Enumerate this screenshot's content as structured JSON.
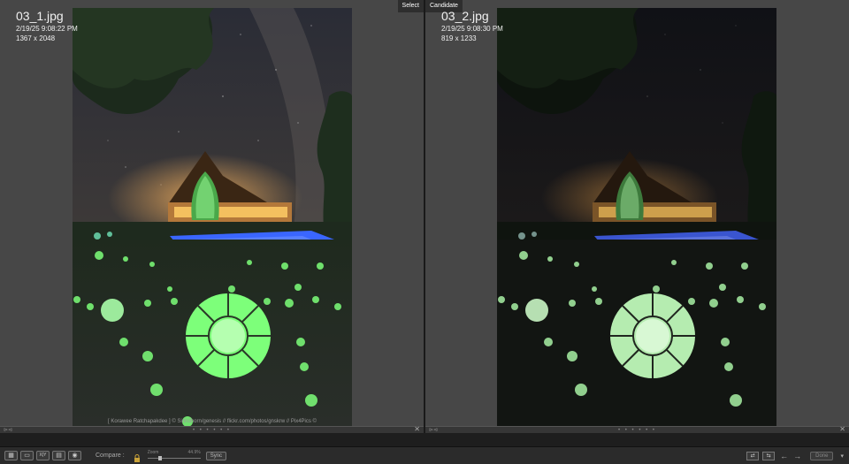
{
  "select_pane": {
    "tag": "Select",
    "filename": "03_1.jpg",
    "datetime": "2/19/25 9:08:22 PM",
    "dimensions": "1367 x 2048",
    "credit": "[ Korawee Ratchapakdee ] © Sirindhorn/genesis // flickr.com/photos/gnskrw // Pix4Pics ©"
  },
  "candidate_pane": {
    "tag": "Candidate",
    "filename": "03_2.jpg",
    "datetime": "2/19/25 9:08:30 PM",
    "dimensions": "819 x 1233"
  },
  "pane_bottom": {
    "grip": "• • • • • •",
    "close": "✕",
    "marker": "⊳⊲"
  },
  "toolbar": {
    "grid_icon": "▦",
    "loupe_icon": "▭",
    "xy_label": "X|Y",
    "survey_icon": "▤",
    "people_icon": "◉",
    "compare_label": "Compare :",
    "zoom_label": "Zoom",
    "zoom_value": "44.9%",
    "sync_label": "Sync",
    "swap_icon": "⇄",
    "make_select_icon": "⇆",
    "prev_arrow": "←",
    "next_arrow": "→",
    "done_label": "Done",
    "caret": "▾"
  },
  "colors": {
    "pane_bg": "#474747",
    "toolbar_bg": "#2b2b2b",
    "glow_green": "#7dff7a",
    "pool_blue": "#3a66ff"
  }
}
